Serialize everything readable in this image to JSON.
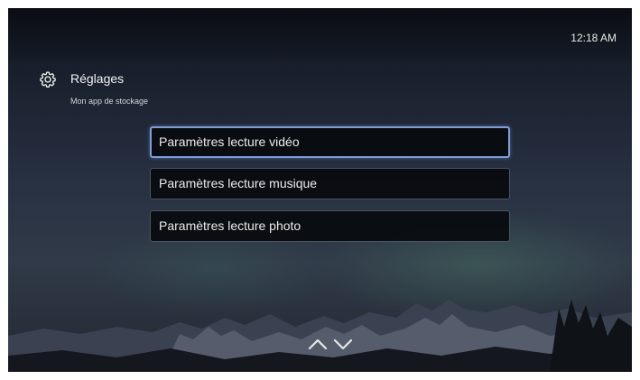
{
  "status": {
    "time": "12:18 AM"
  },
  "header": {
    "icon": "gear-icon",
    "title": "Réglages",
    "subtitle": "Mon app de stockage"
  },
  "menu": {
    "selected_index": 0,
    "items": [
      {
        "label": "Paramètres lecture vidéo"
      },
      {
        "label": "Paramètres lecture musique"
      },
      {
        "label": "Paramètres lecture photo"
      }
    ]
  },
  "navigation": {
    "icons": [
      "chevron-up-icon",
      "chevron-down-icon"
    ]
  },
  "colors": {
    "selection_border": "#7f9dd6",
    "item_background": "#08090e",
    "text": "#ececec"
  }
}
